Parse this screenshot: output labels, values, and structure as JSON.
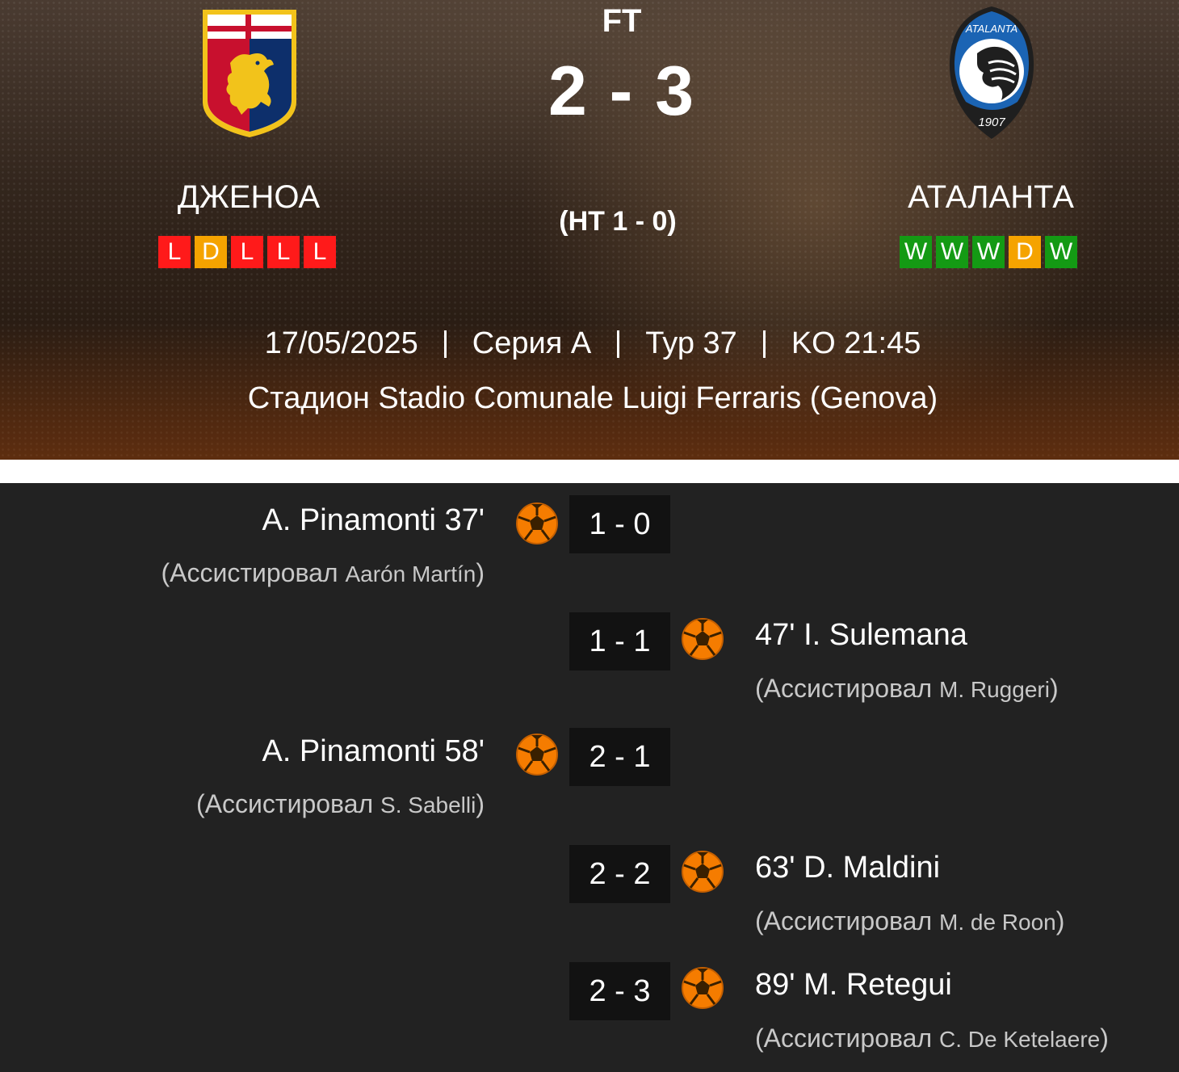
{
  "match": {
    "status": "FT",
    "score": "2 - 3",
    "halftime": "(HT 1 - 0)",
    "date": "17/05/2025",
    "competition": "Серия А",
    "round": "Тур 37",
    "kickoff": "KO 21:45",
    "venue": "Стадион Stadio Comunale Luigi Ferraris (Genova)"
  },
  "home": {
    "name": "ДЖЕНОА",
    "form": [
      "L",
      "D",
      "L",
      "L",
      "L"
    ],
    "crest_icon": "genoa-crest-icon"
  },
  "away": {
    "name": "АТАЛАНТА",
    "form": [
      "W",
      "W",
      "W",
      "D",
      "W"
    ],
    "crest_icon": "atalanta-crest-icon",
    "crest_text": "ATALANTA",
    "crest_year": "1907"
  },
  "colors": {
    "loss": "#ff1a1a",
    "draw": "#f5a300",
    "win": "#149a14",
    "ball": "#f57c00",
    "panel": "#222222"
  },
  "goals": [
    {
      "side": "home",
      "scorer": "A. Pinamonti 37'",
      "assist_prefix": "(Ассистировал ",
      "assist_player": "Aarón Martín",
      "assist_suffix": ")",
      "score": "1 - 0"
    },
    {
      "side": "away",
      "scorer": "47' I. Sulemana",
      "assist_prefix": "(Ассистировал ",
      "assist_player": "M. Ruggeri",
      "assist_suffix": ")",
      "score": "1 - 1"
    },
    {
      "side": "home",
      "scorer": "A. Pinamonti 58'",
      "assist_prefix": "(Ассистировал ",
      "assist_player": "S. Sabelli",
      "assist_suffix": ")",
      "score": "2 - 1"
    },
    {
      "side": "away",
      "scorer": "63' D. Maldini",
      "assist_prefix": "(Ассистировал ",
      "assist_player": "M. de Roon",
      "assist_suffix": ")",
      "score": "2 - 2"
    },
    {
      "side": "away",
      "scorer": "89' M. Retegui",
      "assist_prefix": "(Ассистировал ",
      "assist_player": "C. De Ketelaere",
      "assist_suffix": ")",
      "score": "2 - 3"
    }
  ]
}
